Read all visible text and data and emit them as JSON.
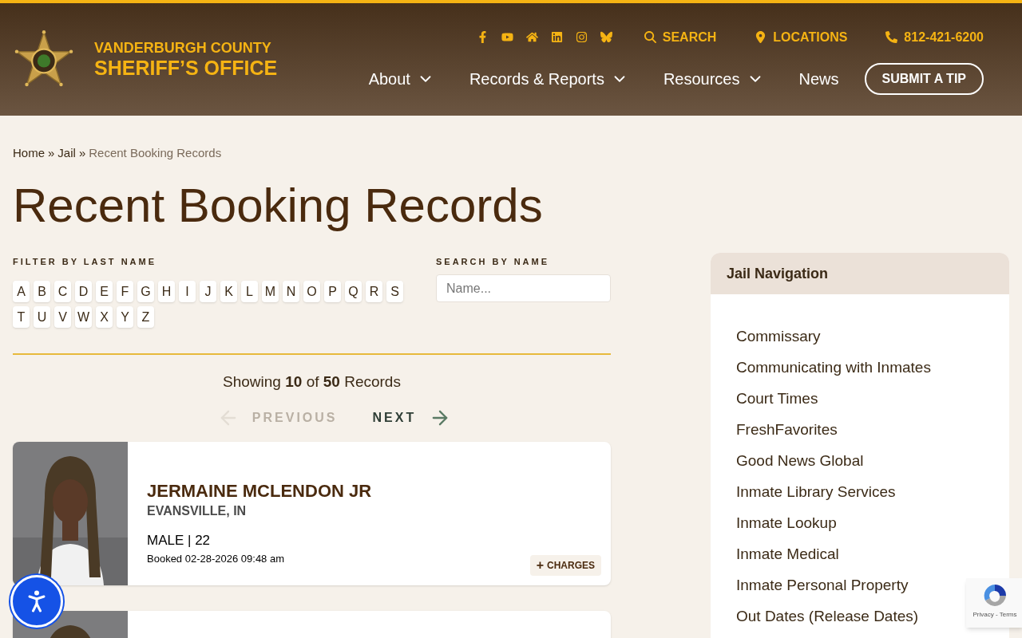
{
  "header": {
    "org_line1": "VANDERBURGH COUNTY",
    "org_line2": "SHERIFF’S OFFICE",
    "social": [
      {
        "kind": "facebook"
      },
      {
        "kind": "youtube"
      },
      {
        "kind": "home"
      },
      {
        "kind": "linkedin"
      },
      {
        "kind": "instagram"
      },
      {
        "kind": "butterfly"
      }
    ],
    "utility": [
      {
        "kind": "search",
        "label": "SEARCH"
      },
      {
        "kind": "location",
        "label": "LOCATIONS"
      },
      {
        "kind": "phone",
        "label": "812-421-6200"
      }
    ],
    "nav": [
      {
        "label": "About",
        "dropdown": true
      },
      {
        "label": "Records & Reports",
        "dropdown": true
      },
      {
        "label": "Resources",
        "dropdown": true
      },
      {
        "label": "News",
        "dropdown": false
      }
    ],
    "tip_button": "SUBMIT A TIP"
  },
  "breadcrumb": [
    {
      "label": "Home",
      "current": false
    },
    {
      "label": "Jail",
      "current": false
    },
    {
      "label": "Recent Booking Records",
      "current": true
    }
  ],
  "breadcrumb_separator": "»",
  "page_title": "Recent Booking Records",
  "filter": {
    "label": "FILTER BY LAST NAME",
    "letters": [
      "A",
      "B",
      "C",
      "D",
      "E",
      "F",
      "G",
      "H",
      "I",
      "J",
      "K",
      "L",
      "M",
      "N",
      "O",
      "P",
      "Q",
      "R",
      "S",
      "T",
      "U",
      "V",
      "W",
      "X",
      "Y",
      "Z"
    ]
  },
  "search": {
    "label": "SEARCH BY NAME",
    "placeholder": "Name..."
  },
  "summary": "Showing **10** of **50** Records",
  "pagination": [
    {
      "kind": "previous",
      "label": "PREVIOUS",
      "disabled": true
    },
    {
      "kind": "next",
      "label": "NEXT",
      "disabled": false
    }
  ],
  "records": [
    {
      "name": "JERMAINE MCLENDON JR",
      "city": "EVANSVILLE, IN",
      "sex_age": "MALE | 22",
      "booked": "Booked 02-28-2026 09:48 am",
      "charges_button": "CHARGES",
      "charges_icon": "+"
    },
    {
      "photo": {
        "kind": "picture"
      }
    }
  ],
  "sidebar": {
    "title": "Jail Navigation",
    "items": [
      "Commissary",
      "Communicating with Inmates",
      "Court Times",
      "FreshFavorites",
      "Good News Global",
      "Inmate Library Services",
      "Inmate Lookup",
      "Inmate Medical",
      "Inmate Personal Property",
      "Out Dates (Release Dates)"
    ]
  },
  "recaptcha": {
    "links": "Privacy - Terms"
  }
}
